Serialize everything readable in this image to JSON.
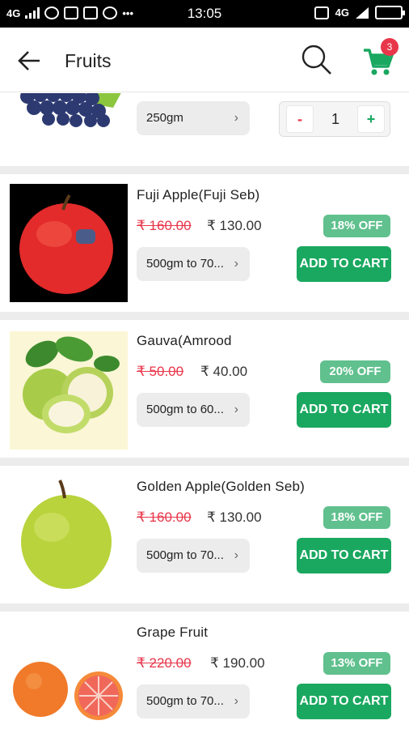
{
  "status_bar": {
    "network": "4G",
    "time": "13:05",
    "right_network": "4G"
  },
  "header": {
    "title": "Fruits",
    "cart_count": "3"
  },
  "items": [
    {
      "name": "",
      "weight": "250gm",
      "quantity": "1",
      "minus_label": "-",
      "plus_label": "+"
    },
    {
      "name": "Fuji Apple(Fuji Seb)",
      "mrp": "₹ 160.00",
      "price": "₹ 130.00",
      "discount": "18% OFF",
      "weight": "500gm to 70...",
      "button": "ADD TO CART"
    },
    {
      "name": "Gauva(Amrood",
      "mrp": "₹ 50.00",
      "price": "₹ 40.00",
      "discount": "20% OFF",
      "weight": "500gm to 60...",
      "button": "ADD TO CART"
    },
    {
      "name": "Golden Apple(Golden Seb)",
      "mrp": "₹ 160.00",
      "price": "₹ 130.00",
      "discount": "18% OFF",
      "weight": "500gm to 70...",
      "button": "ADD TO CART"
    },
    {
      "name": "Grape Fruit",
      "mrp": "₹ 220.00",
      "price": "₹ 190.00",
      "discount": "13% OFF",
      "weight": "500gm to 70...",
      "button": "ADD TO CART"
    }
  ],
  "icons": {
    "back": "arrow-left-icon",
    "search": "search-icon",
    "cart": "cart-icon"
  },
  "colors": {
    "accent_green": "#1aa860",
    "badge_green": "#60c08e",
    "strike_red": "#e8364a"
  }
}
